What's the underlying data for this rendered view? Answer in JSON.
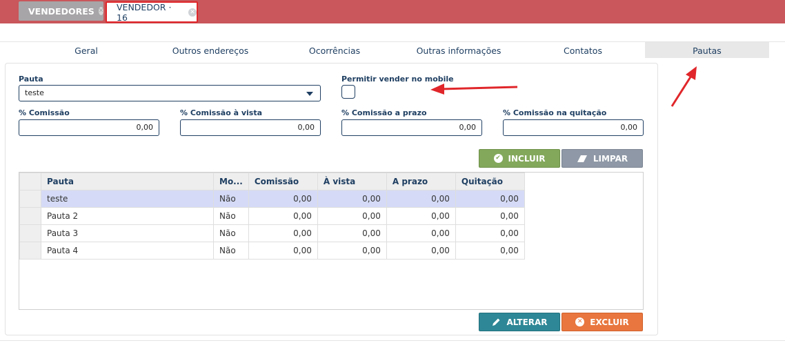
{
  "tabs": [
    {
      "label": "VENDEDORES"
    },
    {
      "label": "VENDEDOR · 16"
    }
  ],
  "subtabs": [
    "Geral",
    "Outros endereços",
    "Ocorrências",
    "Outras informações",
    "Contatos",
    "Pautas"
  ],
  "form": {
    "pauta_label": "Pauta",
    "pauta_value": "teste",
    "mobile_label": "Permitir vender no mobile",
    "comissao_label": "% Comissão",
    "comissao_value": "0,00",
    "comissao_vista_label": "% Comissão à vista",
    "comissao_vista_value": "0,00",
    "comissao_prazo_label": "% Comissão a prazo",
    "comissao_prazo_value": "0,00",
    "comissao_quitacao_label": "% Comissão na quitação",
    "comissao_quitacao_value": "0,00"
  },
  "buttons": {
    "incluir": "INCLUIR",
    "limpar": "LIMPAR",
    "alterar": "ALTERAR",
    "excluir": "EXCLUIR"
  },
  "table": {
    "headers": [
      "Pauta",
      "Mo...",
      "Comissão",
      "À vista",
      "A prazo",
      "Quitação"
    ],
    "rows": [
      [
        "teste",
        "Não",
        "0,00",
        "0,00",
        "0,00",
        "0,00"
      ],
      [
        "Pauta 2",
        "Não",
        "0,00",
        "0,00",
        "0,00",
        "0,00"
      ],
      [
        "Pauta 3",
        "Não",
        "0,00",
        "0,00",
        "0,00",
        "0,00"
      ],
      [
        "Pauta 4",
        "Não",
        "0,00",
        "0,00",
        "0,00",
        "0,00"
      ]
    ]
  },
  "colors": {
    "topbar": "#c9575b",
    "accent_navy": "#1f3f62",
    "annotation_red": "#e0262a"
  }
}
